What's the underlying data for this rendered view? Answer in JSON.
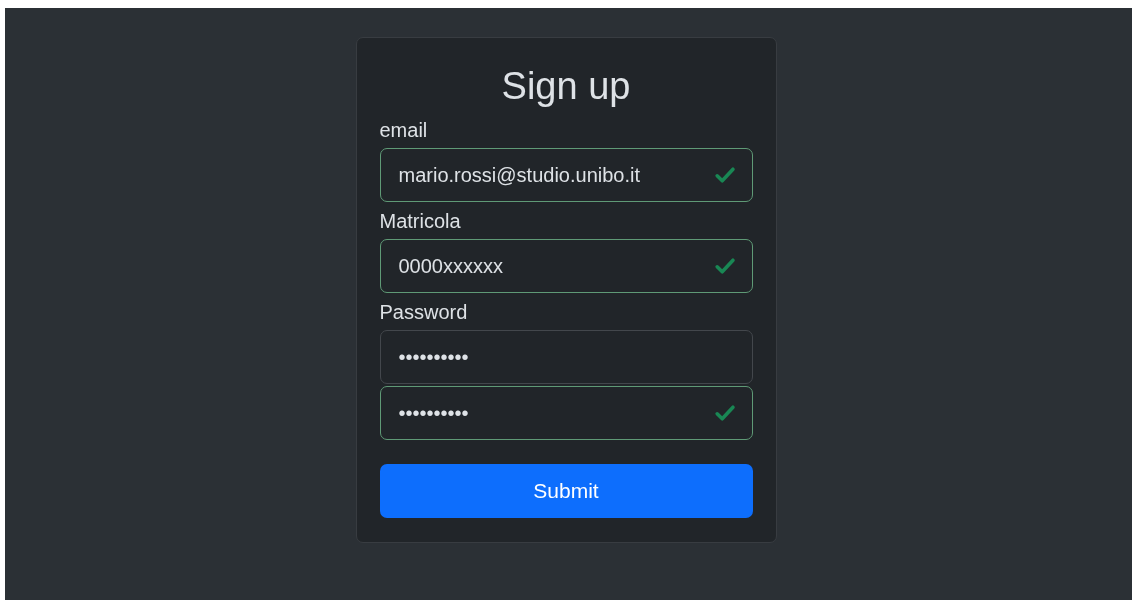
{
  "title": "Sign up",
  "fields": [
    {
      "label": "email",
      "value": "mario.rossi@studio.unibo.it",
      "valid": true
    },
    {
      "label": "Matricola",
      "value": "0000xxxxxx",
      "valid": true
    },
    {
      "label": "Password",
      "value": "••••••••••",
      "valid": false
    },
    {
      "value": "••••••••••",
      "valid": true
    }
  ],
  "submit": "Submit"
}
